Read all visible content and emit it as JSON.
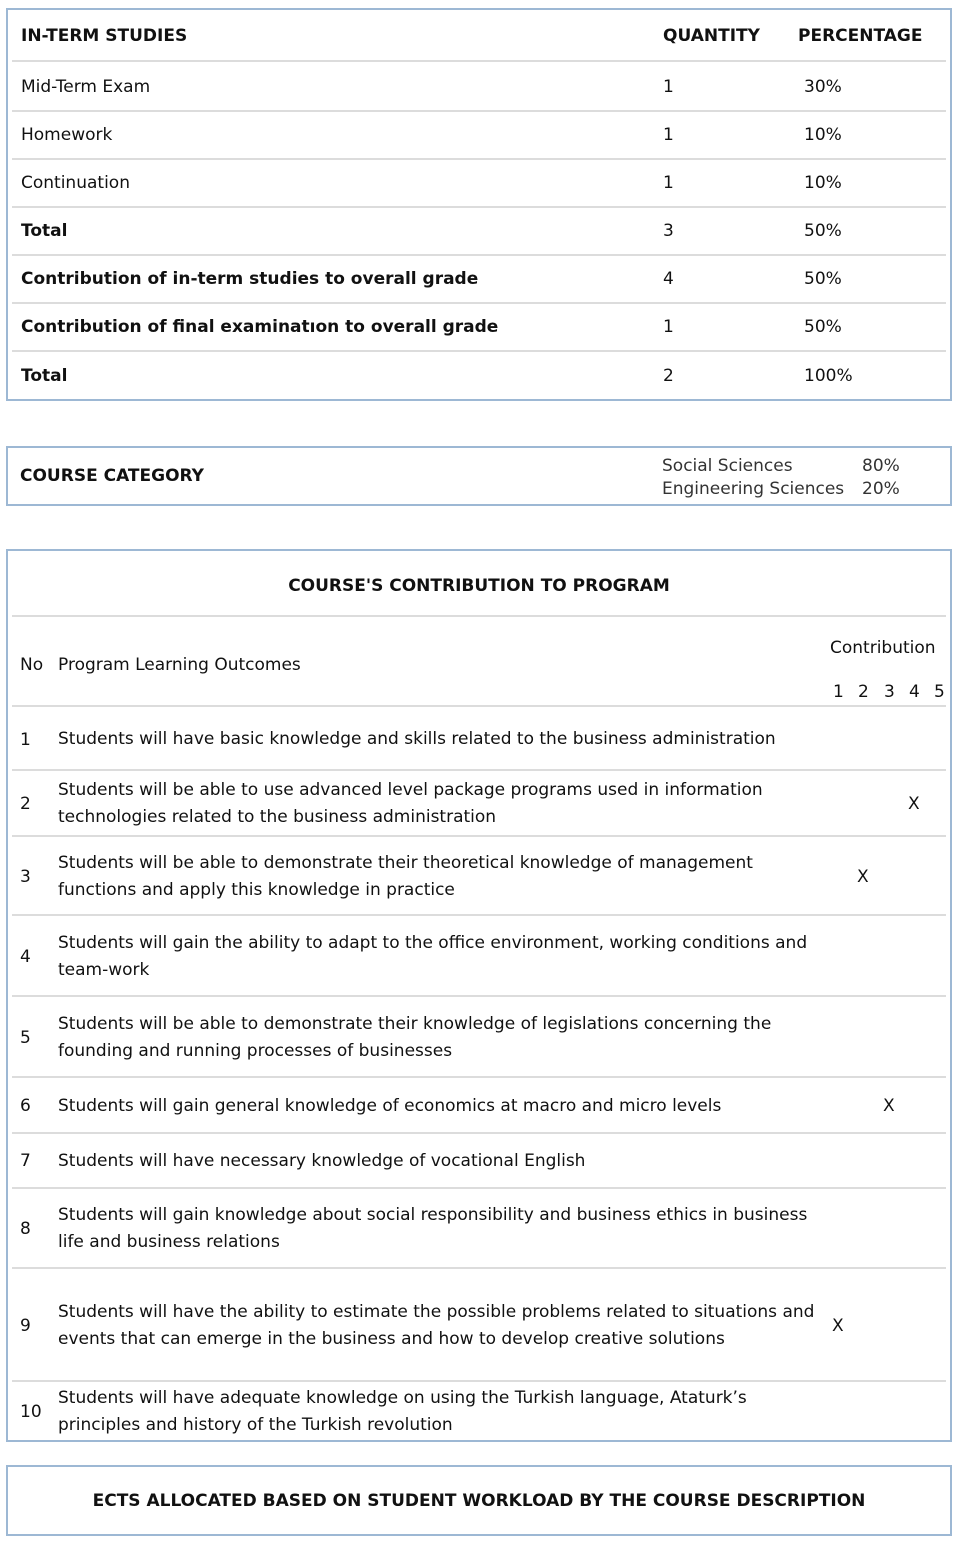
{
  "interm": {
    "headers": [
      "IN-TERM STUDIES",
      "QUANTITY",
      "PERCENTAGE"
    ],
    "rows": [
      {
        "label": "Mid-Term Exam",
        "qty": "1",
        "pct": "30%",
        "bold": false
      },
      {
        "label": "Homework",
        "qty": "1",
        "pct": "10%",
        "bold": false
      },
      {
        "label": "Continuation",
        "qty": "1",
        "pct": "10%",
        "bold": false
      },
      {
        "label": "Total",
        "qty": "3",
        "pct": "50%",
        "bold": true
      },
      {
        "label": "Contribution of in-term studies to overall grade",
        "qty": "4",
        "pct": "50%",
        "bold": true
      },
      {
        "label": "Contribution of final examinatıon to overall grade",
        "qty": "1",
        "pct": "50%",
        "bold": true
      },
      {
        "label": "Total",
        "qty": "2",
        "pct": "100%",
        "bold": true
      }
    ]
  },
  "category": {
    "label": "COURSE CATEGORY",
    "items": [
      {
        "name": "Social Sciences",
        "pct": "80%"
      },
      {
        "name": "Engineering Sciences",
        "pct": "20%"
      }
    ]
  },
  "program": {
    "title": "COURSE'S CONTRIBUTION TO PROGRAM",
    "no_header": "No",
    "outcome_header": "Program Learning Outcomes",
    "contribution_header": "Contribution",
    "levels": [
      "1",
      "2",
      "3",
      "4",
      "5"
    ],
    "mark": "X",
    "outcomes": [
      {
        "no": "1",
        "text": "Students will have basic knowledge and skills related to the business administration",
        "level": null
      },
      {
        "no": "2",
        "text": "Students will be able to use advanced level package programs used in information technologies related to the business administration",
        "level": 4
      },
      {
        "no": "3",
        "text": "Students will be able to demonstrate their theoretical knowledge of management functions and apply this knowledge in practice",
        "level": 2
      },
      {
        "no": "4",
        "text": "Students will gain the ability to adapt to the office environment, working conditions and team-work",
        "level": null
      },
      {
        "no": "5",
        "text": "Students will be able to demonstrate their knowledge of legislations concerning the founding and running processes of businesses",
        "level": null
      },
      {
        "no": "6",
        "text": "Students will gain general knowledge of economics at macro and micro levels",
        "level": 3
      },
      {
        "no": "7",
        "text": "Students will have necessary knowledge of vocational English",
        "level": null
      },
      {
        "no": "8",
        "text": "Students will gain knowledge about social responsibility and business ethics in business life and business relations",
        "level": null
      },
      {
        "no": "9",
        "text": "Students will have the ability to estimate the possible problems related to situations and events that can emerge in the business and how to develop creative solutions",
        "level": 1
      },
      {
        "no": "10",
        "text": "Students will have adequate knowledge on using the Turkish language, Ataturk’s principles and history of the Turkish revolution",
        "level": null
      }
    ]
  },
  "ects": {
    "title": "ECTS ALLOCATED BASED ON STUDENT WORKLOAD BY THE COURSE DESCRIPTION"
  }
}
